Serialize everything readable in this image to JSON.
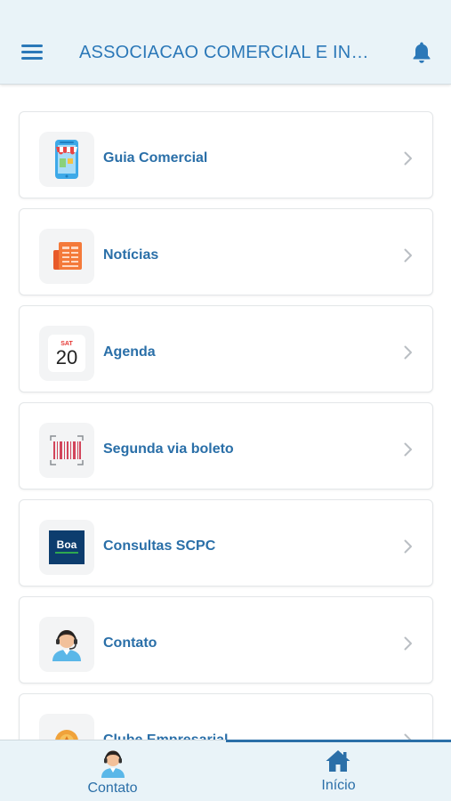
{
  "header": {
    "title": "ASSOCIACAO COMERCIAL E INDU...",
    "menu_icon": "hamburger-menu-icon",
    "bell_icon": "bell-icon",
    "accent_color": "#2b78b8",
    "background_color": "#e9f3f8"
  },
  "menu": {
    "items": [
      {
        "label": "Guia Comercial",
        "icon": "store-phone-icon"
      },
      {
        "label": "Notícias",
        "icon": "newspaper-icon"
      },
      {
        "label": "Agenda",
        "icon": "calendar-icon",
        "calendar_day": "SAT",
        "calendar_date": "20"
      },
      {
        "label": "Segunda via boleto",
        "icon": "barcode-icon"
      },
      {
        "label": "Consultas SCPC",
        "icon": "boa-vista-logo-icon",
        "logo_text": "Boa"
      },
      {
        "label": "Contato",
        "icon": "support-agent-icon"
      },
      {
        "label": "Clube Empresarial",
        "icon": "badge-icon"
      }
    ]
  },
  "bottom_nav": {
    "tabs": [
      {
        "label": "Contato",
        "icon": "support-agent-icon"
      },
      {
        "label": "Início",
        "icon": "home-icon",
        "active": true
      }
    ]
  }
}
